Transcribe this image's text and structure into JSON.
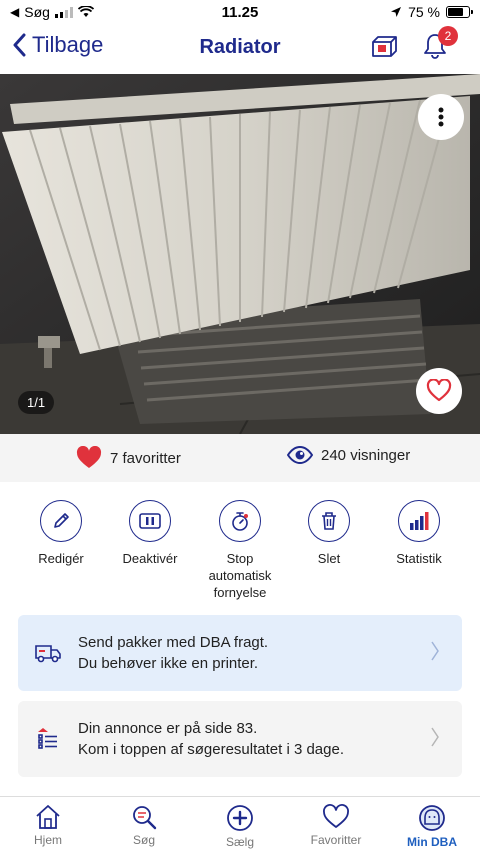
{
  "status": {
    "carrier": "Søg",
    "time": "11.25",
    "battery": "75 %",
    "battery_level": 0.75
  },
  "header": {
    "back_label": "Tilbage",
    "title": "Radiator",
    "notifications_count": "2"
  },
  "photo": {
    "counter": "1/1"
  },
  "stats": {
    "favorites": "7 favoritter",
    "views": "240 visninger"
  },
  "actions": [
    {
      "label": "Redigér",
      "icon": "pencil-icon"
    },
    {
      "label": "Deaktivér",
      "icon": "pause-icon"
    },
    {
      "label": "Stop automatisk fornyelse",
      "icon": "stopwatch-icon"
    },
    {
      "label": "Slet",
      "icon": "trash-icon"
    },
    {
      "label": "Statistik",
      "icon": "bar-chart-icon"
    }
  ],
  "cards": {
    "shipping": {
      "line1": "Send pakker med DBA fragt.",
      "line2": "Du behøver ikke en printer."
    },
    "ranking": {
      "line1": "Din annonce er på side 83.",
      "line2": "Kom i toppen af søgeresultatet i 3 dage."
    }
  },
  "tabbar": {
    "items": [
      {
        "label": "Hjem",
        "icon": "home-icon"
      },
      {
        "label": "Søg",
        "icon": "search-list-icon"
      },
      {
        "label": "Sælg",
        "icon": "plus-circle-icon"
      },
      {
        "label": "Favoritter",
        "icon": "heart-icon"
      },
      {
        "label": "Min DBA",
        "icon": "profile-icon"
      }
    ],
    "active": "Min DBA"
  },
  "colors": {
    "brand": "#1f2a8c",
    "active_tab": "#1f5fbf",
    "heart": "#e0323c",
    "info_card": "#e4eefb",
    "neutral_card": "#f4f4f4"
  }
}
